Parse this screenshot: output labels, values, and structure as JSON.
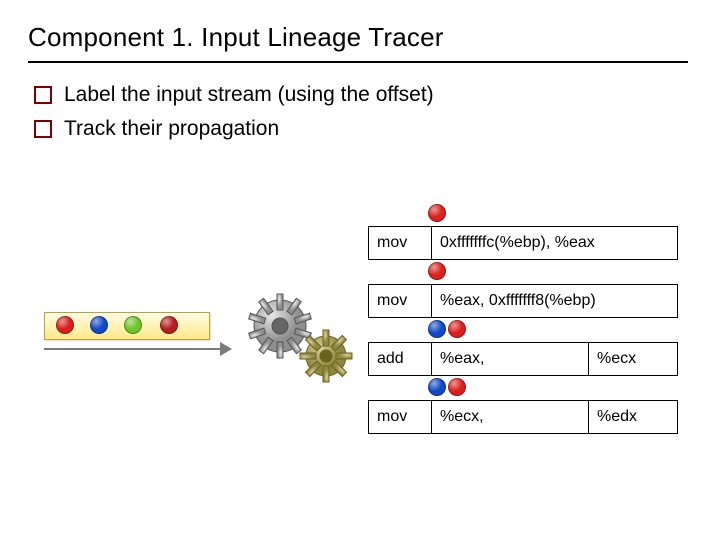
{
  "title": "Component 1. Input Lineage Tracer",
  "bullets": [
    "Label the input stream (using the offset)",
    "Track their propagation"
  ],
  "stream_balls": [
    "red",
    "blue",
    "green",
    "dred"
  ],
  "instructions": [
    {
      "op": "mov",
      "args": "0xfffffffc(%ebp), %eax",
      "balls": [
        "red"
      ]
    },
    {
      "op": "mov",
      "args": "%eax, 0xfffffff8(%ebp)",
      "balls": [
        "red"
      ]
    },
    {
      "op": "add",
      "arg1": "%eax,",
      "arg2": "%ecx",
      "balls": [
        "blue",
        "red"
      ]
    },
    {
      "op": "mov",
      "arg1": "%ecx,",
      "arg2": "%edx",
      "balls": [
        "blue",
        "red"
      ]
    }
  ]
}
